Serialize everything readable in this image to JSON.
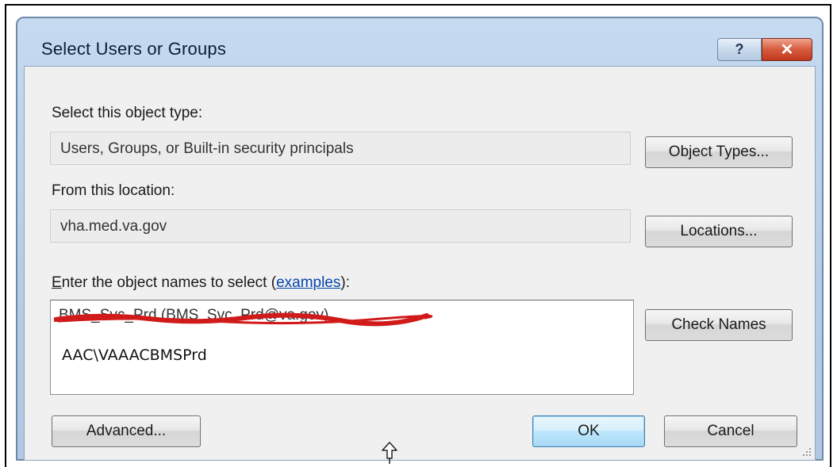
{
  "window": {
    "title": "Select Users or Groups",
    "help_glyph": "?",
    "close_glyph": "✕"
  },
  "object_type": {
    "label": "Select this object type:",
    "value": "Users, Groups, or Built-in security principals",
    "button": "Object Types..."
  },
  "location": {
    "label": "From this location:",
    "value": "vha.med.va.gov",
    "button": "Locations..."
  },
  "names": {
    "label_mnemonic": "E",
    "label_rest": "nter the object names to select (",
    "link": "examples",
    "label_end": "):",
    "line1": "BMS_Svc_Prd (BMS_Svc_Prd@va.gov)",
    "line2": "AAC\\VAAACBMSPrd",
    "check_button": "Check Names"
  },
  "footer": {
    "advanced": "Advanced...",
    "ok": "OK",
    "cancel": "Cancel"
  },
  "colors": {
    "title_text": "#0c1d3a",
    "close_red": "#c2391d",
    "redaction_red": "#d11a1a",
    "link_blue": "#0645ad"
  },
  "icons": [
    "help-icon",
    "close-icon",
    "resize-grip-icon",
    "cursor-arrow-icon"
  ]
}
